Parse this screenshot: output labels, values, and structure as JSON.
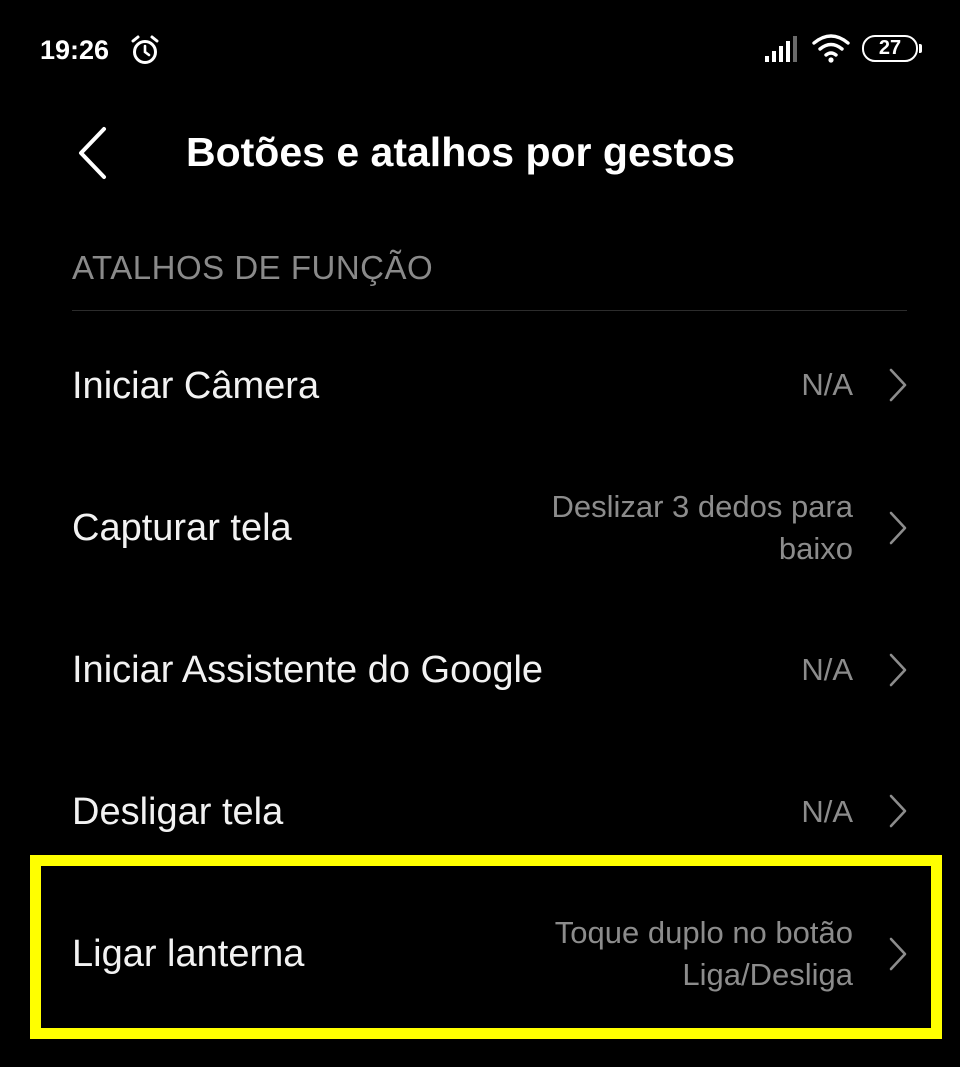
{
  "status_bar": {
    "time": "19:26",
    "battery_level": "27",
    "icons": [
      "alarm-icon",
      "signal-icon",
      "wifi-icon",
      "battery-icon"
    ]
  },
  "header": {
    "back_icon": "chevron-left-icon",
    "title": "Botões e atalhos por gestos"
  },
  "section": {
    "title": "ATALHOS DE FUNÇÃO"
  },
  "rows": [
    {
      "label": "Iniciar Câmera",
      "value_lines": [
        "N/A"
      ]
    },
    {
      "label": "Capturar tela",
      "value_lines": [
        "Deslizar 3 dedos para",
        "baixo"
      ]
    },
    {
      "label": "Iniciar Assistente do Google",
      "value_lines": [
        "N/A"
      ]
    },
    {
      "label": "Desligar tela",
      "value_lines": [
        "N/A"
      ]
    },
    {
      "label": "Ligar lanterna",
      "value_lines": [
        "Toque duplo no botão",
        "Liga/Desliga"
      ]
    }
  ],
  "colors": {
    "background": "#000000",
    "primary_text": "#f2f2f2",
    "secondary_text": "#8c8c8c",
    "highlight": "#ffff00"
  },
  "highlighted_row": "Ligar lanterna"
}
